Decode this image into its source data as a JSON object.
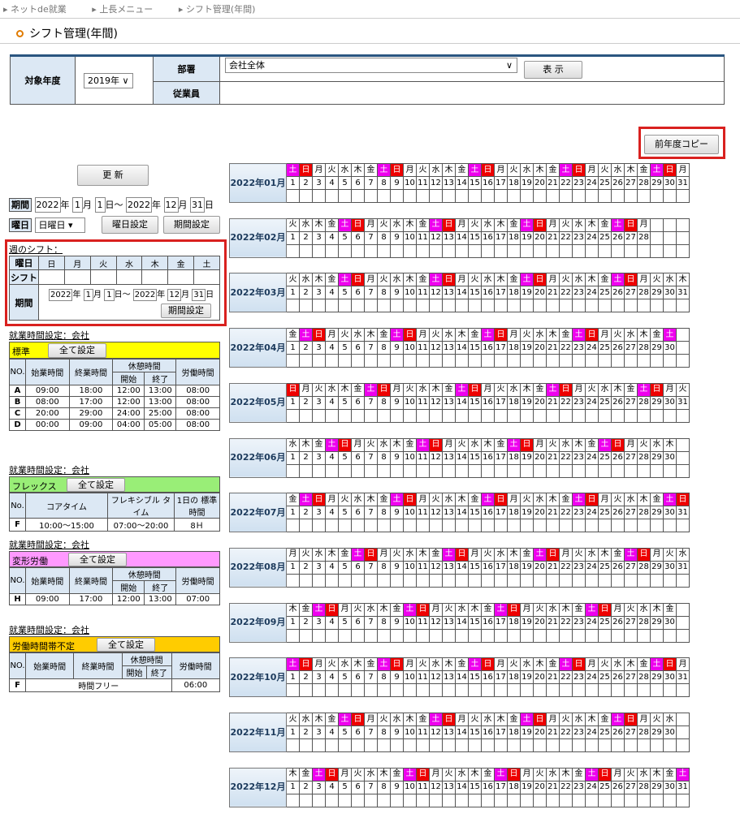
{
  "breadcrumb": [
    "ネットde就業",
    "上長メニュー",
    "シフト管理(年間)"
  ],
  "page_title": "シフト管理(年間)",
  "filter": {
    "year_label": "対象年度",
    "year_value": "2019年",
    "dept_label": "部署",
    "dept_value": "会社全体",
    "show_label": "表 示",
    "emp_label": "従業員"
  },
  "copy_button": "前年度コピー",
  "update_button": "更 新",
  "period": {
    "label": "期間",
    "y1": "2022",
    "m1": "1",
    "d1": "1",
    "y2": "2022",
    "m2": "12",
    "d2": "31",
    "yr": "年",
    "mo": "月",
    "dy": "日",
    "tilde": "〜"
  },
  "weekday": {
    "label": "曜日",
    "value": "日曜日",
    "set_button": "曜日設定",
    "period_button": "期間設定"
  },
  "weekly": {
    "title": "週のシフト：",
    "day_label": "曜日",
    "days": [
      "日",
      "月",
      "火",
      "水",
      "木",
      "金",
      "土"
    ],
    "shift_label": "シフト",
    "period_label": "期間",
    "y1": "2022",
    "m1": "1",
    "d1": "1",
    "y2": "2022",
    "m2": "12",
    "d2": "31",
    "period_button": "期間設定"
  },
  "work_title": "就業時間設定：会社",
  "set_all": "全て設定",
  "standard": {
    "name": "標準",
    "h": {
      "no": "NO.",
      "start": "始業時間",
      "end": "終業時間",
      "break": "休憩時間",
      "bs": "開始",
      "be": "終了",
      "work": "労働時間"
    },
    "rows": [
      {
        "no": "A",
        "start": "09:00",
        "end": "18:00",
        "bs": "12:00",
        "be": "13:00",
        "work": "08:00"
      },
      {
        "no": "B",
        "start": "08:00",
        "end": "17:00",
        "bs": "12:00",
        "be": "13:00",
        "work": "08:00"
      },
      {
        "no": "C",
        "start": "20:00",
        "end": "29:00",
        "bs": "24:00",
        "be": "25:00",
        "work": "08:00"
      },
      {
        "no": "D",
        "start": "00:00",
        "end": "09:00",
        "bs": "04:00",
        "be": "05:00",
        "work": "08:00"
      }
    ]
  },
  "flex": {
    "name": "フレックス",
    "h": {
      "no": "No.",
      "core": "コアタイム",
      "flexi": "フレキシブル タイム",
      "std": "1日の 標準時間"
    },
    "row": {
      "no": "F",
      "core": "10:00〜15:00",
      "flexi": "07:00〜20:00",
      "std": "8Ｈ"
    }
  },
  "variable": {
    "name": "変形労働",
    "h": {
      "no": "NO.",
      "start": "始業時間",
      "end": "終業時間",
      "break": "休憩時間",
      "bs": "開始",
      "be": "終了",
      "work": "労働時間"
    },
    "row": {
      "no": "H",
      "start": "09:00",
      "end": "17:00",
      "bs": "12:00",
      "be": "13:00",
      "work": "07:00"
    }
  },
  "free": {
    "name": "労働時間帯不定",
    "h": {
      "no": "NO.",
      "start": "始業時間",
      "end": "終業時間",
      "break": "休憩時間",
      "bs": "開始",
      "be": "終了",
      "work": "労働時間"
    },
    "row": {
      "no": "F",
      "free": "時間フリー",
      "work": "06:00"
    }
  },
  "months": [
    {
      "label": "2022年01月",
      "days": 31,
      "first": 6
    },
    {
      "label": "2022年02月",
      "days": 28,
      "first": 2
    },
    {
      "label": "2022年03月",
      "days": 31,
      "first": 2
    },
    {
      "label": "2022年04月",
      "days": 30,
      "first": 5
    },
    {
      "label": "2022年05月",
      "days": 31,
      "first": 0
    },
    {
      "label": "2022年06月",
      "days": 30,
      "first": 3
    },
    {
      "label": "2022年07月",
      "days": 31,
      "first": 5
    },
    {
      "label": "2022年08月",
      "days": 31,
      "first": 1
    },
    {
      "label": "2022年09月",
      "days": 30,
      "first": 4
    },
    {
      "label": "2022年10月",
      "days": 31,
      "first": 6
    },
    {
      "label": "2022年11月",
      "days": 30,
      "first": 2
    },
    {
      "label": "2022年12月",
      "days": 31,
      "first": 4
    }
  ],
  "weekday_chars": [
    "日",
    "月",
    "火",
    "水",
    "木",
    "金",
    "土"
  ],
  "colors": {
    "saturday": "#ee00ee",
    "sunday": "#ee0000",
    "standard": "#ffff00",
    "flex": "#99ee77",
    "variable": "#ff99ff",
    "free": "#ffcc00"
  }
}
